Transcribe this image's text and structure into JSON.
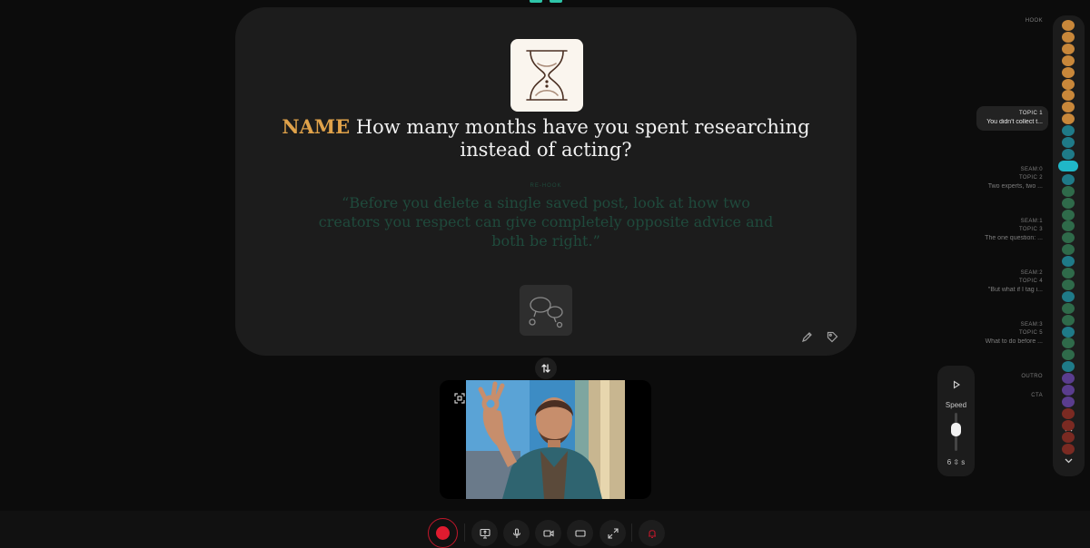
{
  "prompt": {
    "name_token": "NAME",
    "question": "How many months have you spent researching instead of acting?",
    "rehook_label": "RE-HOOK",
    "rehook_quote": "“Before you delete a single saved post, look at how two creators you respect can give completely opposite advice and both be right.”"
  },
  "speed": {
    "label": "Speed",
    "value": "6",
    "level_fraction": 0.6
  },
  "outline": {
    "hook": "HOOK",
    "topic1_label": "TOPIC 1",
    "topic1_text": "You didn't collect t...",
    "seam0": "SEAM:0",
    "topic2_label": "TOPIC 2",
    "topic2_text": "Two experts, two ...",
    "seam1": "SEAM:1",
    "topic3_label": "TOPIC 3",
    "topic3_text": "The one question: ...",
    "seam2": "SEAM:2",
    "topic4_label": "TOPIC 4",
    "topic4_text": "\"But what if I tag i...",
    "seam3": "SEAM:3",
    "topic5_label": "TOPIC 5",
    "topic5_text": "What to do before ...",
    "outro": "OUTRO",
    "cta": "CTA"
  },
  "colors": {
    "accent_name": "#e0a24a",
    "rehook_text": "#1f4a3c",
    "record": "#e01b2f",
    "seg_hook": "#c8873a",
    "seg_topic": "#1f7a88",
    "seg_active": "#20b7c8",
    "seg_green": "#2f6a4a",
    "seg_purple": "#5a3d8e",
    "seg_red": "#7a2a22"
  },
  "icons": {
    "hourglass": "hourglass-icon",
    "speech": "speech-bubbles-icon",
    "edit": "pencil-icon",
    "tag": "tag-icon",
    "swap": "swap-vertical-icon",
    "fit": "fit-screen-icon",
    "record": "record-icon",
    "present": "presentation-icon",
    "mic": "microphone-icon",
    "camera": "video-camera-icon",
    "aspect": "aspect-ratio-icon",
    "expand": "expand-icon",
    "alert": "bell-icon",
    "play": "play-icon",
    "up": "chevron-up-icon",
    "down": "chevron-down-icon"
  }
}
